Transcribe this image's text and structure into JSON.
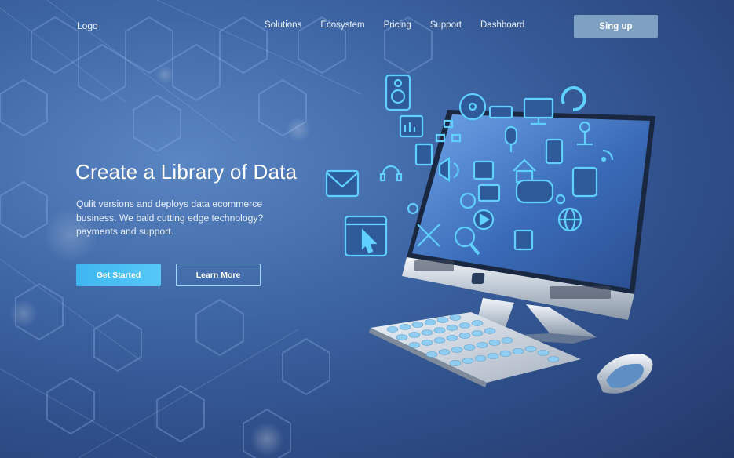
{
  "nav": {
    "logo": "Logo",
    "links": [
      "Solutions",
      "Ecosystem",
      "Pricing",
      "Support",
      "Dashboard"
    ],
    "signup_label": "Sing up"
  },
  "hero": {
    "title": "Create a Library of Data",
    "description": "Qulit versions and deploys data ecommerce business. We bald cutting edge technology? payments and support.",
    "primary_button": "Get Started",
    "secondary_button": "Learn More"
  },
  "colors": {
    "background_dark": "#24386a",
    "background_light": "#5a86c2",
    "accent": "#3fb6f1",
    "signup_bg": "#8cafcd",
    "icon_color": "#5fd0ff"
  },
  "illustration": {
    "icons": [
      "speaker-icon",
      "film-reel-icon",
      "keyboard-icon",
      "monitor-icon",
      "refresh-icon",
      "bar-chart-icon",
      "network-icon",
      "microphone-icon",
      "antenna-icon",
      "rss-icon",
      "sd-card-icon",
      "tablet-icon",
      "mail-icon",
      "headphones-icon",
      "volume-icon",
      "equalizer-icon",
      "home-icon",
      "telephone-icon",
      "globe-icon",
      "gear-icon",
      "clapperboard-icon",
      "game-controller-icon",
      "at-sign-icon",
      "play-icon",
      "cursor-window-icon",
      "tools-icon",
      "magnifier-icon",
      "calendar-icon",
      "user-icon"
    ]
  }
}
